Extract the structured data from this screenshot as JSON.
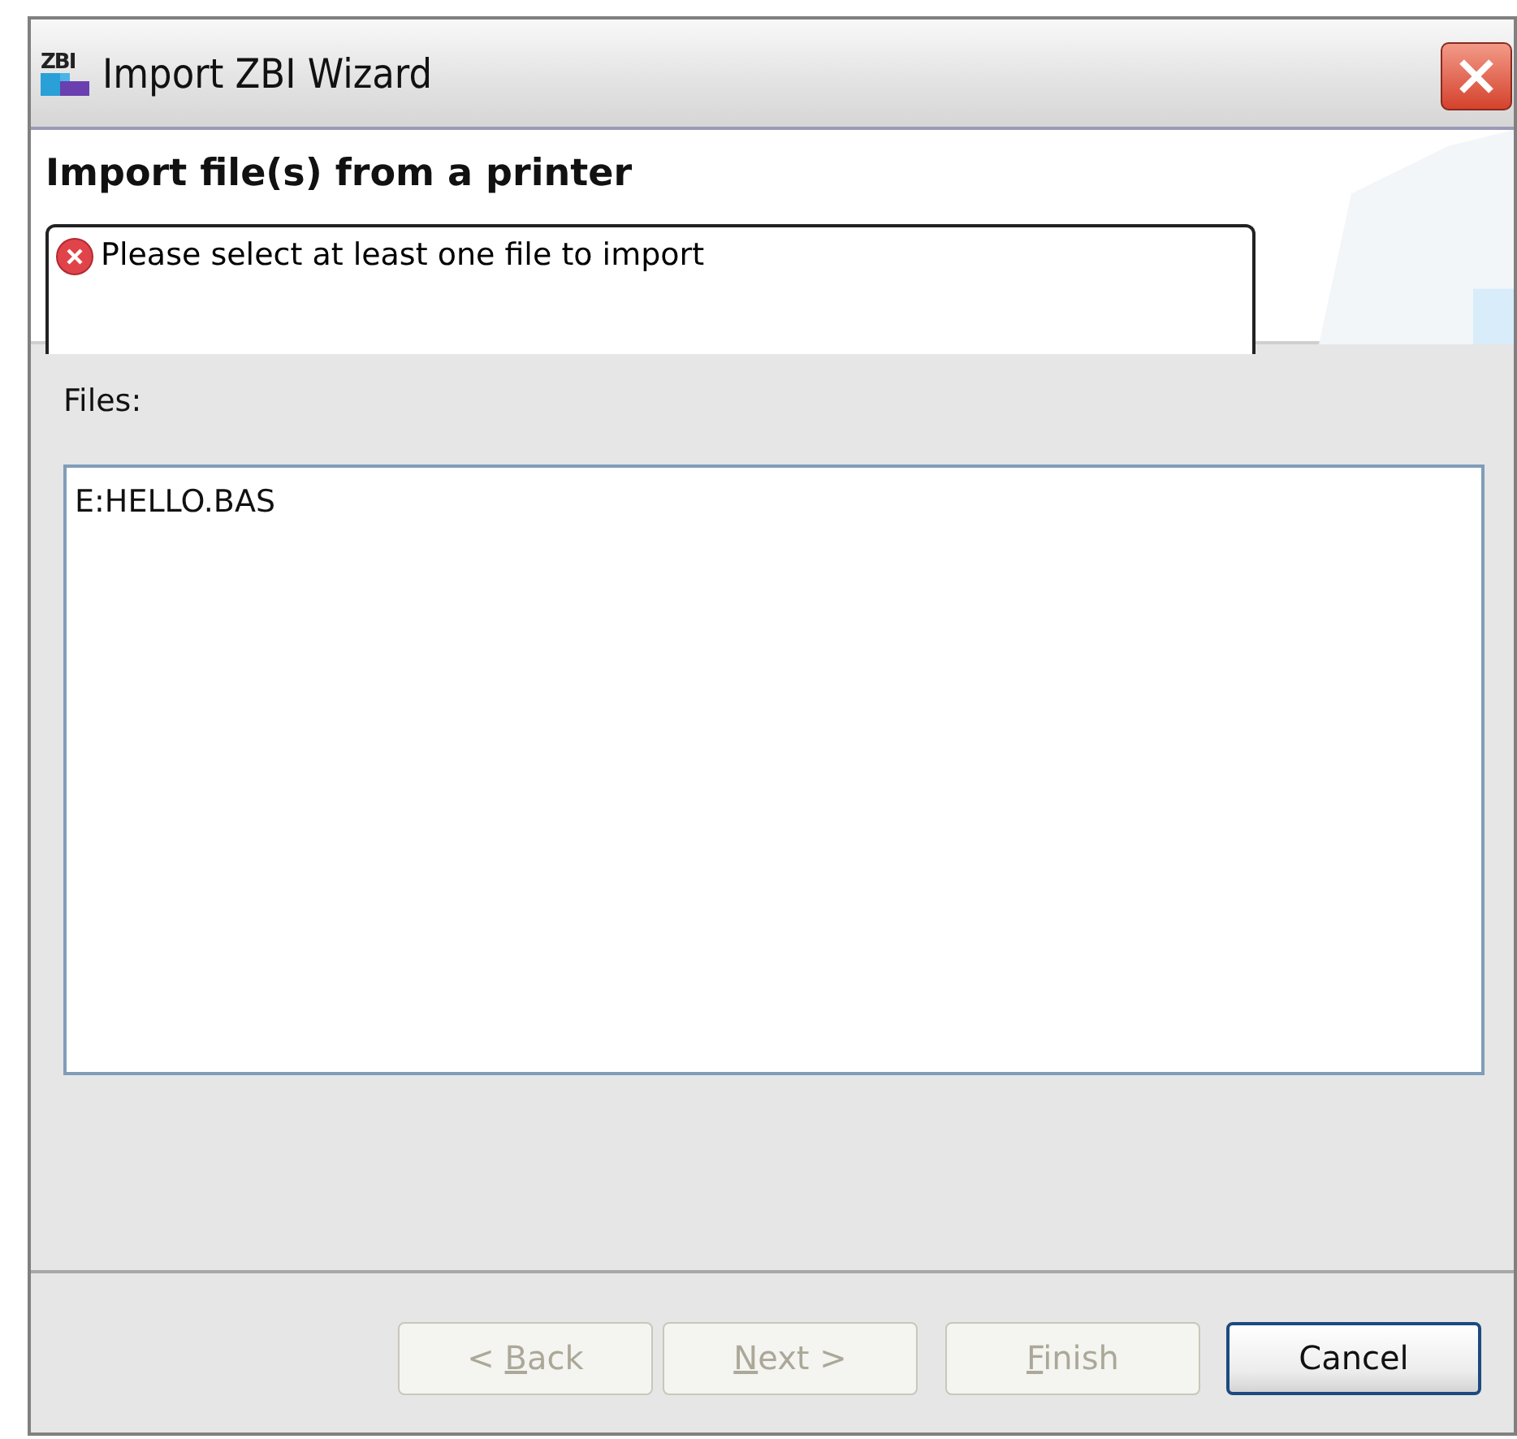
{
  "window": {
    "title": "Import ZBI Wizard",
    "logo_text": "ZBI"
  },
  "header": {
    "title": "Import file(s) from a printer",
    "message": {
      "kind": "error",
      "text": "Please select at least one file to import"
    }
  },
  "files": {
    "label": "Files:",
    "items": [
      {
        "name": "E:HELLO.BAS",
        "selected": false
      }
    ]
  },
  "buttons": [
    {
      "label_parts": [
        {
          "text": "< ",
          "underlined": false
        },
        {
          "text": "B",
          "underlined": true
        },
        {
          "text": "ack",
          "underlined": false
        }
      ],
      "disabled": true,
      "default": false
    },
    {
      "label_parts": [
        {
          "text": "N",
          "underlined": true
        },
        {
          "text": "ext >",
          "underlined": false
        }
      ],
      "disabled": true,
      "default": false
    },
    {
      "label_parts": [
        {
          "text": "F",
          "underlined": true
        },
        {
          "text": "inish",
          "underlined": false
        }
      ],
      "disabled": true,
      "default": false
    },
    {
      "label_parts": [
        {
          "text": "Cancel",
          "underlined": false
        }
      ],
      "disabled": false,
      "default": true
    }
  ]
}
